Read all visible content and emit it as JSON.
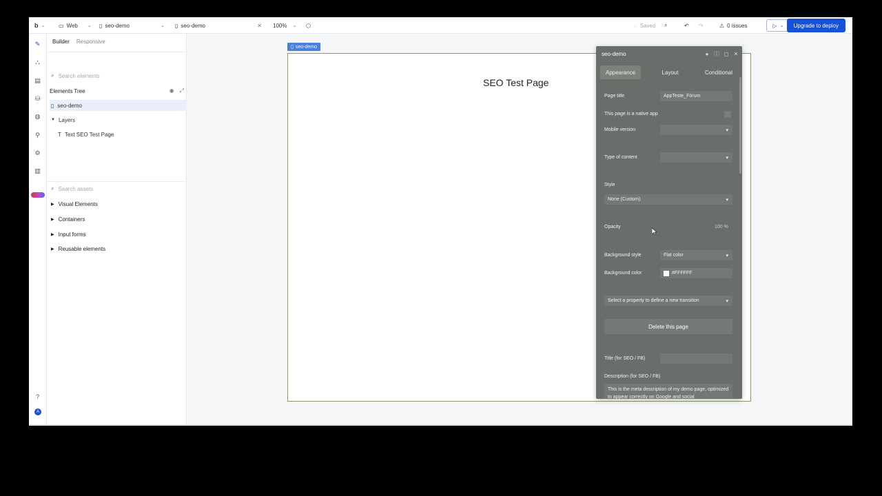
{
  "topbar": {
    "logo": "b",
    "platform": "Web",
    "page_select": "seo-demo",
    "open_tab": "seo-demo",
    "zoom": "100%",
    "saved": "Saved",
    "issues": "0 issues",
    "upgrade": "Upgrade to deploy"
  },
  "panel": {
    "tab_builder": "Builder",
    "tab_responsive": "Responsive",
    "search_elements": "Search elements",
    "tree_title": "Elements Tree",
    "root": "seo-demo",
    "layers": "Layers",
    "text_item": "Text SEO Test Page",
    "search_assets": "Search assets",
    "assets": [
      "Visual Elements",
      "Containers",
      "Input forms",
      "Reusable elements"
    ]
  },
  "canvas": {
    "tag": "seo-demo",
    "heading": "SEO Test Page"
  },
  "editor": {
    "title": "seo-demo",
    "tabs": [
      "Appearance",
      "Layout",
      "Conditional"
    ],
    "page_title_label": "Page title",
    "page_title_value": "AppTeste_Fórum",
    "native_app_label": "This page is a native app",
    "mobile_version_label": "Mobile version",
    "type_content_label": "Type of content",
    "style_label": "Style",
    "style_value": "None (Custom)",
    "opacity_label": "Opacity",
    "opacity_value": "100 %",
    "bg_style_label": "Background style",
    "bg_style_value": "Flat color",
    "bg_color_label": "Background color",
    "bg_color_value": "#FFFFFF",
    "transition_placeholder": "Select a property to define a new transition",
    "delete_page": "Delete this page",
    "seo_title_label": "Title (for SEO / FB)",
    "seo_desc_label": "Description (for SEO / FB)",
    "seo_desc_value": "This is the meta description of my demo page, optimized to appear correctly on Google and social"
  }
}
